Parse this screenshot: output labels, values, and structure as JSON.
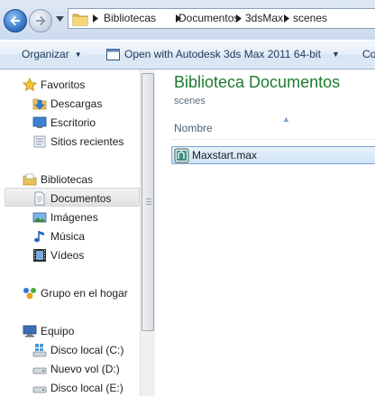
{
  "address_bar": {
    "breadcrumbs": [
      "Bibliotecas",
      "Documentos",
      "3dsMax",
      "scenes"
    ]
  },
  "toolbar": {
    "organize_label": "Organizar",
    "open_with_label": "Open with Autodesk 3ds Max 2011 64-bit",
    "overflow_label": "Co"
  },
  "nav": {
    "favorites": {
      "header": "Favoritos",
      "items": [
        "Descargas",
        "Escritorio",
        "Sitios recientes"
      ]
    },
    "libraries": {
      "header": "Bibliotecas",
      "items": [
        "Documentos",
        "Imágenes",
        "Música",
        "Vídeos"
      ],
      "selected": "Documentos"
    },
    "homegroup": {
      "label": "Grupo en el hogar"
    },
    "computer": {
      "header": "Equipo",
      "items": [
        "Disco local (C:)",
        "Nuevo vol (D:)",
        "Disco local (E:)"
      ]
    }
  },
  "content": {
    "library_title": "Biblioteca Documentos",
    "location": "scenes",
    "column_header": "Nombre",
    "files": [
      {
        "name": "Maxstart.max",
        "selected": true,
        "icon": "3dsmax-file-icon"
      }
    ]
  },
  "colors": {
    "title_green": "#1e7a2e",
    "toolbar_text": "#1e395b",
    "selection_border": "#7da2ce"
  }
}
